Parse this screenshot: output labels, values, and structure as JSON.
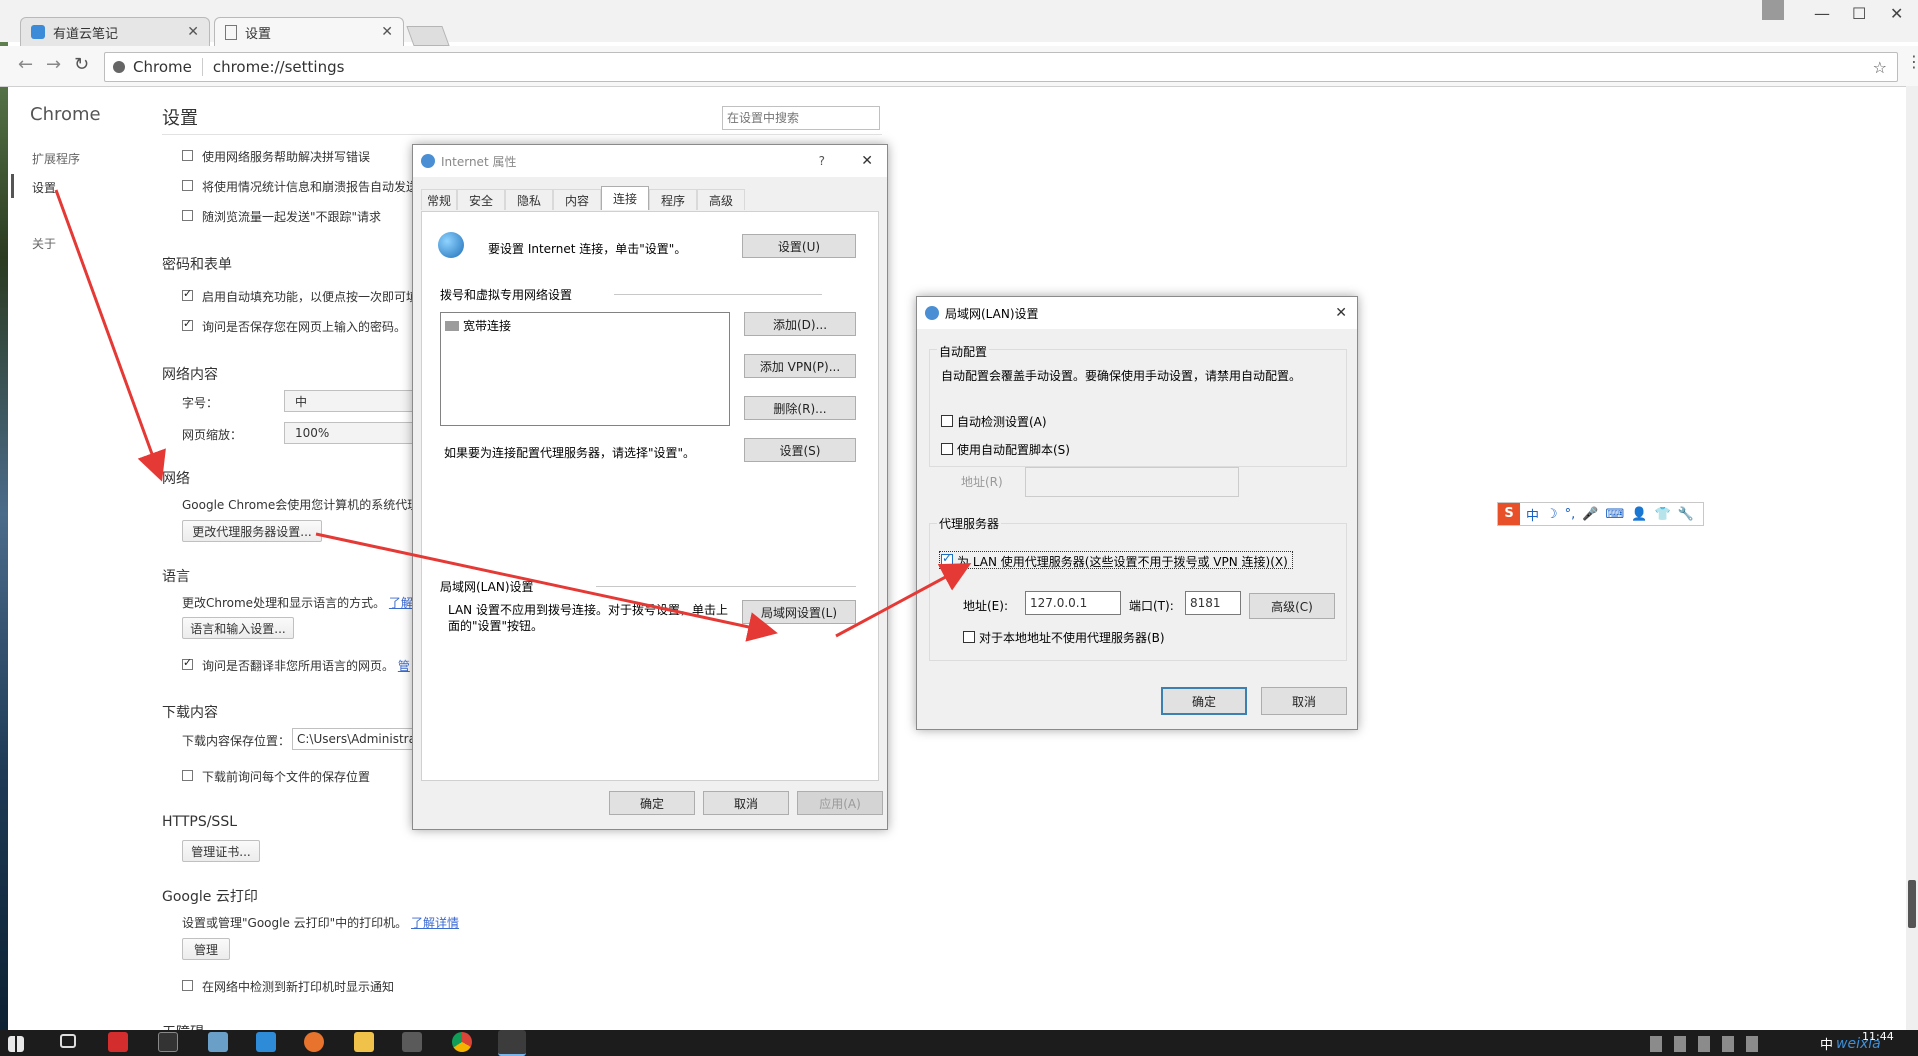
{
  "browser": {
    "tabs": [
      {
        "title": "有道云笔记",
        "active": false
      },
      {
        "title": "设置",
        "active": true
      }
    ],
    "omnibox": {
      "site_label": "Chrome",
      "url": "chrome://settings"
    }
  },
  "settings": {
    "brand": "Chrome",
    "page_title": "设置",
    "search_placeholder": "在设置中搜索",
    "nav": [
      {
        "label": "扩展程序"
      },
      {
        "label": "设置"
      },
      {
        "label": "关于"
      }
    ],
    "privacy_items": [
      {
        "label": "使用网络服务帮助解决拼写错误",
        "checked": false
      },
      {
        "label": "将使用情况统计信息和崩溃报告自动发送",
        "checked": false
      },
      {
        "label": "随浏览流量一起发送\"不跟踪\"请求",
        "checked": false
      }
    ],
    "passwords": {
      "title": "密码和表单",
      "items": [
        {
          "label": "启用自动填充功能，以便点按一次即可填",
          "checked": true
        },
        {
          "label": "询问是否保存您在网页上输入的密码。",
          "checked": true
        }
      ]
    },
    "web_content": {
      "title": "网络内容",
      "font_label": "字号：",
      "font_value": "中",
      "zoom_label": "网页缩放：",
      "zoom_value": "100%"
    },
    "network": {
      "title": "网络",
      "desc": "Google Chrome会使用您计算机的系统代理",
      "button": "更改代理服务器设置..."
    },
    "language": {
      "title": "语言",
      "desc": "更改Chrome处理和显示语言的方式。",
      "link": "了解详",
      "button": "语言和输入设置...",
      "translate_label": "询问是否翻译非您所用语言的网页。",
      "translate_link": "管",
      "translate_checked": true
    },
    "downloads": {
      "title": "下载内容",
      "location_label": "下载内容保存位置：",
      "location_value": "C:\\Users\\Administrato",
      "ask_label": "下载前询问每个文件的保存位置",
      "ask_checked": false
    },
    "https": {
      "title": "HTTPS/SSL",
      "button": "管理证书..."
    },
    "cloud_print": {
      "title": "Google 云打印",
      "desc": "设置或管理\"Google 云打印\"中的打印机。",
      "link": "了解详情",
      "button": "管理",
      "notify_label": "在网络中检测到新打印机时显示通知",
      "notify_checked": false
    },
    "cut_off_title": "无障碍"
  },
  "internet_props": {
    "title": "Internet 属性",
    "help": "?",
    "close": "✕",
    "tabs": [
      "常规",
      "安全",
      "隐私",
      "内容",
      "连接",
      "程序",
      "高级"
    ],
    "active_tab": "连接",
    "setup_text": "要设置 Internet 连接，单击\"设置\"。",
    "setup_button": "设置(U)",
    "dialup_title": "拨号和虚拟专用网络设置",
    "connections": [
      "宽带连接"
    ],
    "add_button": "添加(D)...",
    "add_vpn_button": "添加 VPN(P)...",
    "remove_button": "删除(R)...",
    "settings_button": "设置(S)",
    "proxy_hint": "如果要为连接配置代理服务器，请选择\"设置\"。",
    "lan_title": "局域网(LAN)设置",
    "lan_text": "LAN 设置不应用到拨号连接。对于拨号设置，单击上面的\"设置\"按钮。",
    "lan_button": "局域网设置(L)",
    "ok": "确定",
    "cancel": "取消",
    "apply": "应用(A)"
  },
  "lan_settings": {
    "title": "局域网(LAN)设置",
    "close": "✕",
    "auto_config_title": "自动配置",
    "auto_config_desc": "自动配置会覆盖手动设置。要确保使用手动设置，请禁用自动配置。",
    "auto_detect_label": "自动检测设置(A)",
    "auto_detect_checked": false,
    "auto_script_label": "使用自动配置脚本(S)",
    "auto_script_checked": false,
    "address_label": "地址(R)",
    "proxy_title": "代理服务器",
    "use_proxy_label": "为 LAN 使用代理服务器(这些设置不用于拨号或 VPN 连接)(X)",
    "use_proxy_checked": true,
    "proxy_address_label": "地址(E):",
    "proxy_address_value": "127.0.0.1",
    "port_label": "端口(T):",
    "port_value": "8181",
    "advanced_button": "高级(C)",
    "bypass_local_label": "对于本地地址不使用代理服务器(B)",
    "bypass_local_checked": false,
    "ok": "确定",
    "cancel": "取消"
  },
  "ime_bar": {
    "items": [
      "S",
      "中",
      "☽",
      "°,",
      "🎤",
      "⌨",
      "👤",
      "👕",
      "🔧"
    ]
  },
  "taskbar": {
    "clock": "11:44",
    "ime_indicator": "中",
    "watermark": "weixia"
  },
  "colors": {
    "annotation_arrow": "#e53935",
    "accent": "#1a6fc4",
    "link": "#3b6ad0"
  }
}
